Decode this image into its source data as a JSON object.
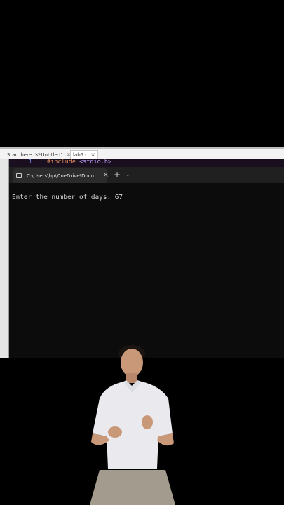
{
  "ide": {
    "tabs": [
      {
        "label": "Start here",
        "close": "×"
      },
      {
        "label": "*Untitled1",
        "close": "×"
      },
      {
        "label": "lab5.c",
        "close": "×"
      }
    ],
    "editor": {
      "line_number": "1",
      "code_prefix": "#include ",
      "code_header": "<stdio.h>"
    }
  },
  "terminal": {
    "tab_title": "C:\\Users\\hp\\OneDrive\\Docum",
    "close_glyph": "×",
    "new_tab_glyph": "+",
    "dropdown_glyph": "⌄",
    "output_line": "Enter the number of days: 67"
  },
  "colors": {
    "terminal_bg": "#0c0c0c",
    "titlebar_bg": "#202020",
    "editor_bg": "#1a0f1f",
    "code_color": "#e08a5a",
    "line_number_color": "#6f8cff"
  }
}
